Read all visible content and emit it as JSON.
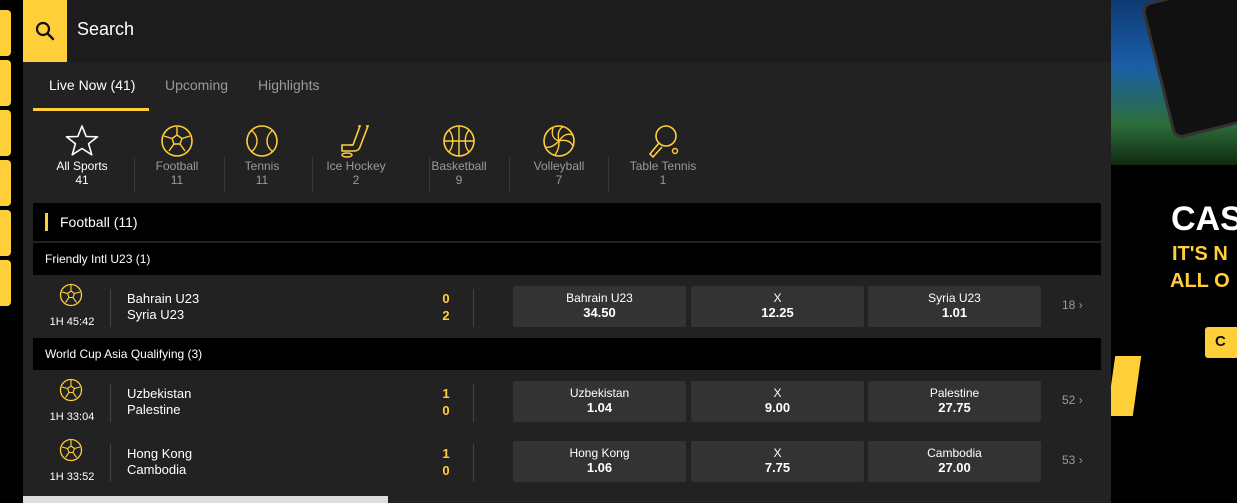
{
  "search": {
    "label": "Search"
  },
  "tabs": [
    {
      "label": "Live Now (41)",
      "active": true
    },
    {
      "label": "Upcoming",
      "active": false
    },
    {
      "label": "Highlights",
      "active": false
    }
  ],
  "sports": [
    {
      "name": "All Sports",
      "count": "41",
      "icon": "star-icon",
      "active": true
    },
    {
      "name": "Football",
      "count": "11",
      "icon": "football-icon"
    },
    {
      "name": "Tennis",
      "count": "11",
      "icon": "tennis-icon"
    },
    {
      "name": "Ice Hockey",
      "count": "2",
      "icon": "ice-hockey-icon"
    },
    {
      "name": "Basketball",
      "count": "9",
      "icon": "basketball-icon"
    },
    {
      "name": "Volleyball",
      "count": "7",
      "icon": "volleyball-icon"
    },
    {
      "name": "Table Tennis",
      "count": "1",
      "icon": "table-tennis-icon"
    }
  ],
  "section": {
    "title": "Football (11)"
  },
  "competitions": [
    {
      "title": "Friendly Intl U23 (1)",
      "matches": [
        {
          "clock": "1H 45:42",
          "home": "Bahrain U23",
          "away": "Syria U23",
          "home_score": "0",
          "away_score": "2",
          "odds": [
            {
              "label": "Bahrain U23",
              "price": "34.50"
            },
            {
              "label": "X",
              "price": "12.25"
            },
            {
              "label": "Syria U23",
              "price": "1.01"
            }
          ],
          "more": "18"
        }
      ]
    },
    {
      "title": "World Cup Asia Qualifying (3)",
      "matches": [
        {
          "clock": "1H 33:04",
          "home": "Uzbekistan",
          "away": "Palestine",
          "home_score": "1",
          "away_score": "0",
          "odds": [
            {
              "label": "Uzbekistan",
              "price": "1.04"
            },
            {
              "label": "X",
              "price": "9.00"
            },
            {
              "label": "Palestine",
              "price": "27.75"
            }
          ],
          "more": "52"
        },
        {
          "clock": "1H 33:52",
          "home": "Hong Kong",
          "away": "Cambodia",
          "home_score": "1",
          "away_score": "0",
          "odds": [
            {
              "label": "Hong Kong",
              "price": "1.06"
            },
            {
              "label": "X",
              "price": "7.75"
            },
            {
              "label": "Cambodia",
              "price": "27.00"
            }
          ],
          "more": "53"
        }
      ]
    }
  ],
  "promo": {
    "title": "CAS",
    "line1": "IT'S N",
    "line2": "ALL O",
    "cta": "C"
  },
  "colors": {
    "accent": "#ffcf3a",
    "panel": "#222222",
    "header": "#000000",
    "odds_cell": "#333333"
  }
}
